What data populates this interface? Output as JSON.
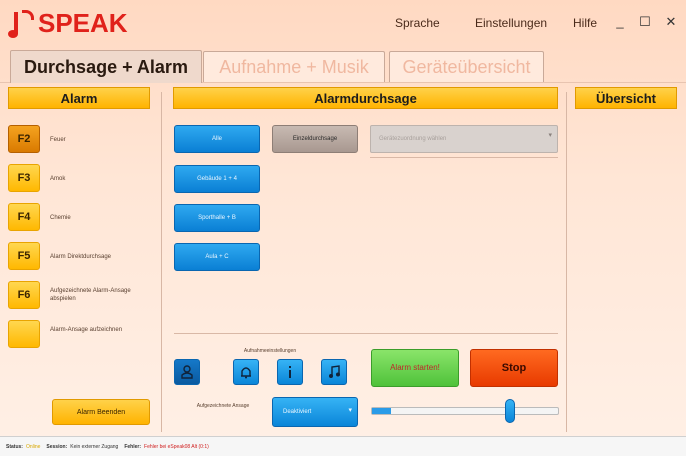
{
  "app": {
    "logo_text": "SPEAK",
    "menu": [
      "Sprache",
      "Einstellungen",
      "Hilfe"
    ],
    "window_controls": [
      "minimize-icon",
      "maximize-icon",
      "close-icon"
    ]
  },
  "tabs": [
    {
      "label": "Durchsage + Alarm",
      "active": true
    },
    {
      "label": "Aufnahme + Musik",
      "active": false
    },
    {
      "label": "Geräteübersicht",
      "active": false
    }
  ],
  "alarm": {
    "header": "Alarm",
    "items": [
      {
        "key": "F2",
        "label": "Feuer",
        "active": true
      },
      {
        "key": "F3",
        "label": "Amok",
        "active": false
      },
      {
        "key": "F4",
        "label": "Chemie",
        "active": false
      },
      {
        "key": "F5",
        "label": "Alarm Direktdurchsage",
        "active": false
      },
      {
        "key": "F6",
        "label": "Aufgezeichnete Alarm-Ansage abspielen",
        "active": false
      },
      {
        "key": "",
        "label": "Alarm-Ansage aufzeichnen",
        "active": false
      }
    ],
    "end_button": "Alarm Beenden"
  },
  "announcement": {
    "header": "Alarmdurchsage",
    "all_button": "Alle",
    "single_button": "Einzeldurchsage",
    "device_dropdown": "Gerätezuordnung wählen",
    "zones": [
      "Gebäude 1 + 4",
      "Sporthalle + B",
      "Aula + C"
    ],
    "recording_label": "Aufnahmeeinstellungen",
    "start_button": "Alarm starten!",
    "stop_button": "Stop",
    "recorded_label": "Aufgezeichnete Ansage",
    "recorded_select": "Deaktiviert",
    "volume_level": 0.1,
    "slider_position": 0.74
  },
  "overview": {
    "header": "Übersicht"
  },
  "status": {
    "status_label": "Status:",
    "status_value": "Online",
    "session_label": "Session:",
    "session_value": "Kein externer Zugang",
    "error_label": "Fehler:",
    "error_value": "Fehler bei eSpeak08 Alt (0:1)"
  },
  "colors": {
    "accent_red": "#e0221b",
    "yellow": "#ffb300",
    "blue": "#0a85d8",
    "green": "#4fc23a",
    "orange_red": "#e83a00"
  }
}
